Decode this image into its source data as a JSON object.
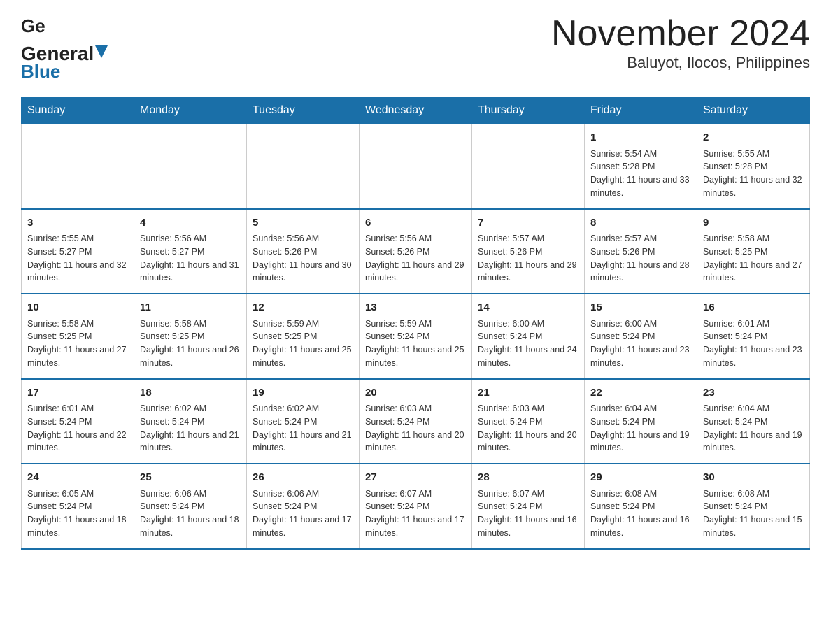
{
  "header": {
    "title": "November 2024",
    "subtitle": "Baluyot, Ilocos, Philippines",
    "logo_general": "General",
    "logo_blue": "Blue"
  },
  "days_of_week": [
    "Sunday",
    "Monday",
    "Tuesday",
    "Wednesday",
    "Thursday",
    "Friday",
    "Saturday"
  ],
  "weeks": [
    [
      {
        "day": "",
        "info": ""
      },
      {
        "day": "",
        "info": ""
      },
      {
        "day": "",
        "info": ""
      },
      {
        "day": "",
        "info": ""
      },
      {
        "day": "",
        "info": ""
      },
      {
        "day": "1",
        "info": "Sunrise: 5:54 AM\nSunset: 5:28 PM\nDaylight: 11 hours and 33 minutes."
      },
      {
        "day": "2",
        "info": "Sunrise: 5:55 AM\nSunset: 5:28 PM\nDaylight: 11 hours and 32 minutes."
      }
    ],
    [
      {
        "day": "3",
        "info": "Sunrise: 5:55 AM\nSunset: 5:27 PM\nDaylight: 11 hours and 32 minutes."
      },
      {
        "day": "4",
        "info": "Sunrise: 5:56 AM\nSunset: 5:27 PM\nDaylight: 11 hours and 31 minutes."
      },
      {
        "day": "5",
        "info": "Sunrise: 5:56 AM\nSunset: 5:26 PM\nDaylight: 11 hours and 30 minutes."
      },
      {
        "day": "6",
        "info": "Sunrise: 5:56 AM\nSunset: 5:26 PM\nDaylight: 11 hours and 29 minutes."
      },
      {
        "day": "7",
        "info": "Sunrise: 5:57 AM\nSunset: 5:26 PM\nDaylight: 11 hours and 29 minutes."
      },
      {
        "day": "8",
        "info": "Sunrise: 5:57 AM\nSunset: 5:26 PM\nDaylight: 11 hours and 28 minutes."
      },
      {
        "day": "9",
        "info": "Sunrise: 5:58 AM\nSunset: 5:25 PM\nDaylight: 11 hours and 27 minutes."
      }
    ],
    [
      {
        "day": "10",
        "info": "Sunrise: 5:58 AM\nSunset: 5:25 PM\nDaylight: 11 hours and 27 minutes."
      },
      {
        "day": "11",
        "info": "Sunrise: 5:58 AM\nSunset: 5:25 PM\nDaylight: 11 hours and 26 minutes."
      },
      {
        "day": "12",
        "info": "Sunrise: 5:59 AM\nSunset: 5:25 PM\nDaylight: 11 hours and 25 minutes."
      },
      {
        "day": "13",
        "info": "Sunrise: 5:59 AM\nSunset: 5:24 PM\nDaylight: 11 hours and 25 minutes."
      },
      {
        "day": "14",
        "info": "Sunrise: 6:00 AM\nSunset: 5:24 PM\nDaylight: 11 hours and 24 minutes."
      },
      {
        "day": "15",
        "info": "Sunrise: 6:00 AM\nSunset: 5:24 PM\nDaylight: 11 hours and 23 minutes."
      },
      {
        "day": "16",
        "info": "Sunrise: 6:01 AM\nSunset: 5:24 PM\nDaylight: 11 hours and 23 minutes."
      }
    ],
    [
      {
        "day": "17",
        "info": "Sunrise: 6:01 AM\nSunset: 5:24 PM\nDaylight: 11 hours and 22 minutes."
      },
      {
        "day": "18",
        "info": "Sunrise: 6:02 AM\nSunset: 5:24 PM\nDaylight: 11 hours and 21 minutes."
      },
      {
        "day": "19",
        "info": "Sunrise: 6:02 AM\nSunset: 5:24 PM\nDaylight: 11 hours and 21 minutes."
      },
      {
        "day": "20",
        "info": "Sunrise: 6:03 AM\nSunset: 5:24 PM\nDaylight: 11 hours and 20 minutes."
      },
      {
        "day": "21",
        "info": "Sunrise: 6:03 AM\nSunset: 5:24 PM\nDaylight: 11 hours and 20 minutes."
      },
      {
        "day": "22",
        "info": "Sunrise: 6:04 AM\nSunset: 5:24 PM\nDaylight: 11 hours and 19 minutes."
      },
      {
        "day": "23",
        "info": "Sunrise: 6:04 AM\nSunset: 5:24 PM\nDaylight: 11 hours and 19 minutes."
      }
    ],
    [
      {
        "day": "24",
        "info": "Sunrise: 6:05 AM\nSunset: 5:24 PM\nDaylight: 11 hours and 18 minutes."
      },
      {
        "day": "25",
        "info": "Sunrise: 6:06 AM\nSunset: 5:24 PM\nDaylight: 11 hours and 18 minutes."
      },
      {
        "day": "26",
        "info": "Sunrise: 6:06 AM\nSunset: 5:24 PM\nDaylight: 11 hours and 17 minutes."
      },
      {
        "day": "27",
        "info": "Sunrise: 6:07 AM\nSunset: 5:24 PM\nDaylight: 11 hours and 17 minutes."
      },
      {
        "day": "28",
        "info": "Sunrise: 6:07 AM\nSunset: 5:24 PM\nDaylight: 11 hours and 16 minutes."
      },
      {
        "day": "29",
        "info": "Sunrise: 6:08 AM\nSunset: 5:24 PM\nDaylight: 11 hours and 16 minutes."
      },
      {
        "day": "30",
        "info": "Sunrise: 6:08 AM\nSunset: 5:24 PM\nDaylight: 11 hours and 15 minutes."
      }
    ]
  ]
}
